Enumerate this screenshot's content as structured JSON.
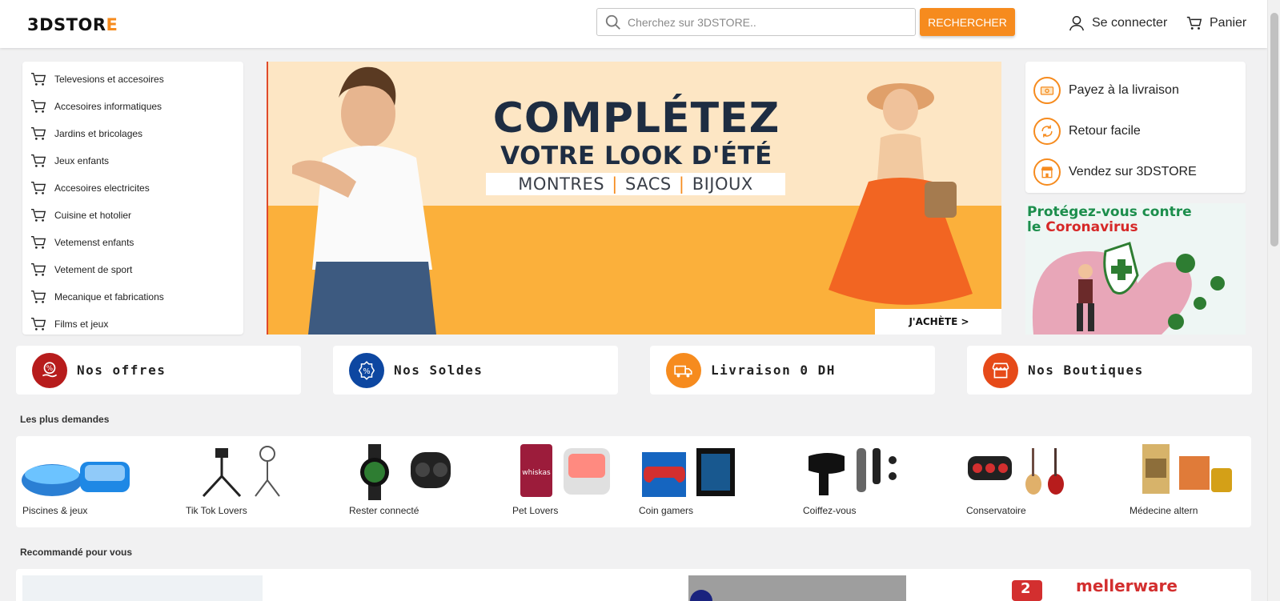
{
  "header": {
    "logo_main": "3DSTOR",
    "logo_accent": "E",
    "search_placeholder": "Cherchez sur 3DSTORE..",
    "search_button": "RECHERCHER",
    "login_label": "Se connecter",
    "cart_label": "Panier"
  },
  "categories": [
    "Televesions et accesoires",
    "Accesoires informatiques",
    "Jardins et bricolages",
    "Jeux enfants",
    "Accesoires electricites",
    "Cuisine et hotolier",
    "Vetemenst enfants",
    "Vetement de sport",
    "Mecanique et fabrications",
    "Films et jeux"
  ],
  "banner": {
    "title_line1": "COMPLÉTEZ",
    "title_line2": "VOTRE LOOK D'ÉTÉ",
    "tags": [
      "MONTRES",
      "SACS",
      "BIJOUX"
    ],
    "cta": "J'ACHÈTE >"
  },
  "services": [
    {
      "label": "Payez à la livraison",
      "icon": "cash-icon"
    },
    {
      "label": "Retour facile",
      "icon": "return-icon"
    },
    {
      "label": "Vendez sur 3DSTORE",
      "icon": "store-icon"
    }
  ],
  "corona_ad": {
    "line1": "Protégez-vous contre",
    "line2_prefix": "le",
    "line2_highlight": "Coronavirus"
  },
  "tiles": [
    {
      "label": "Nos offres",
      "color": "#b71c1c",
      "icon": "offer-hand-icon"
    },
    {
      "label": "Nos Soldes",
      "color": "#0d47a1",
      "icon": "discount-badge-icon"
    },
    {
      "label": "Livraison 0 DH",
      "color": "#f68b1e",
      "icon": "truck-icon"
    },
    {
      "label": "Nos Boutiques",
      "color": "#e64a19",
      "icon": "shop-icon"
    }
  ],
  "most_demanded": {
    "title": "Les plus demandes",
    "items": [
      "Piscines & jeux",
      "Tik Tok Lovers",
      "Rester connecté",
      "Pet Lovers",
      "Coin gamers",
      "Coiffez-vous",
      "Conservatoire",
      "Médecine altern"
    ]
  },
  "recommended": {
    "title": "Recommandé pour vous",
    "brand_visible": "mellerware",
    "badge_number": "2"
  },
  "colors": {
    "accent": "#f68b1e",
    "background": "#f1f1f2",
    "banner_bg": "#fde6c4"
  }
}
